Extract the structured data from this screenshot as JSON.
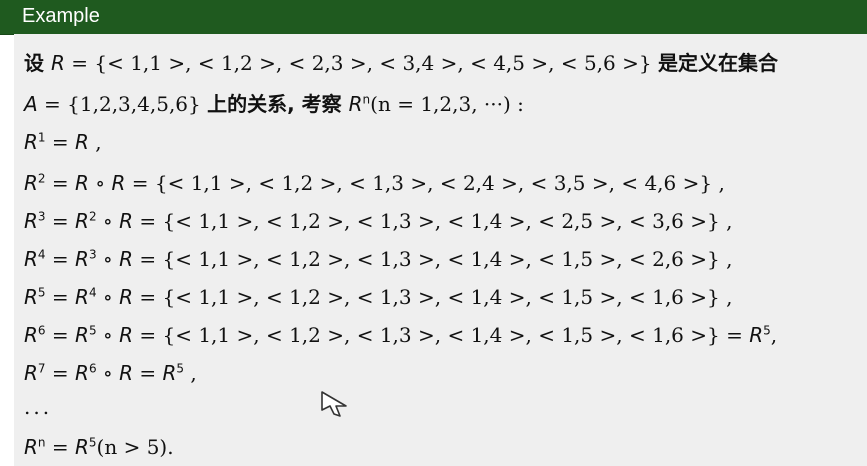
{
  "header": {
    "title": "Example"
  },
  "lines": {
    "l1": {
      "pre": "设 ",
      "var": "R",
      "eq": " = {< 1,1 >, < 1,2 >, < 2,3 >, < 3,4 >, < 4,5 >, < 5,6 >} ",
      "cn": "是定义在集合"
    },
    "l2": {
      "var": "A",
      "eq": " = {1,2,3,4,5,6} ",
      "cn": "上的关系, 考察 ",
      "var2": "R",
      "sup2": "n",
      "tail": "(n = 1,2,3, ···) :"
    },
    "l3": {
      "lhs": "R",
      "lsup": "1",
      "eq": " = ",
      "rhs": "R",
      "tail": " ,"
    },
    "l4": {
      "lhs": "R",
      "lsup": "2",
      "eq": " = ",
      "rhs": "R",
      "comp": " ∘ ",
      "rhs2": "R",
      "tail": " = {< 1,1 >, < 1,2 >, < 1,3 >, < 2,4 >, < 3,5 >, < 4,6 >} ,"
    },
    "l5": {
      "lhs": "R",
      "lsup": "3",
      "eq": " = ",
      "rhs": "R",
      "rsup": "2",
      "comp": " ∘ ",
      "rhs2": "R",
      "tail": " = {< 1,1 >, < 1,2 >, < 1,3 >, < 1,4 >, < 2,5 >, < 3,6 >} ,"
    },
    "l6": {
      "lhs": "R",
      "lsup": "4",
      "eq": " = ",
      "rhs": "R",
      "rsup": "3",
      "comp": " ∘ ",
      "rhs2": "R",
      "tail": " = {< 1,1 >, < 1,2 >, < 1,3 >, < 1,4 >, < 1,5 >, < 2,6 >} ,"
    },
    "l7": {
      "lhs": "R",
      "lsup": "5",
      "eq": " = ",
      "rhs": "R",
      "rsup": "4",
      "comp": " ∘ ",
      "rhs2": "R",
      "tail": " = {< 1,1 >, < 1,2 >, < 1,3 >, < 1,4 >, < 1,5 >, < 1,6 >} ,"
    },
    "l8": {
      "lhs": "R",
      "lsup": "6",
      "eq": " = ",
      "rhs": "R",
      "rsup": "5",
      "comp": " ∘ ",
      "rhs2": "R",
      "tail": " = {< 1,1 >, < 1,2 >, < 1,3 >, < 1,4 >, < 1,5 >, < 1,6 >} = ",
      "end": "R",
      "endsup": "5",
      "endtail": ","
    },
    "l9": {
      "lhs": "R",
      "lsup": "7",
      "eq": " = ",
      "rhs": "R",
      "rsup": "6",
      "comp": " ∘ ",
      "rhs2": "R",
      "eq2": " = ",
      "end": "R",
      "endsup": "5",
      "tail": " ,"
    },
    "l10": {
      "dots": "..."
    },
    "l11": {
      "lhs": "R",
      "lsup": "n",
      "eq": " = ",
      "rhs": "R",
      "rsup": "5",
      "tail": "(n > 5)."
    }
  },
  "icons": {
    "cursor": "mouse-pointer-icon"
  }
}
